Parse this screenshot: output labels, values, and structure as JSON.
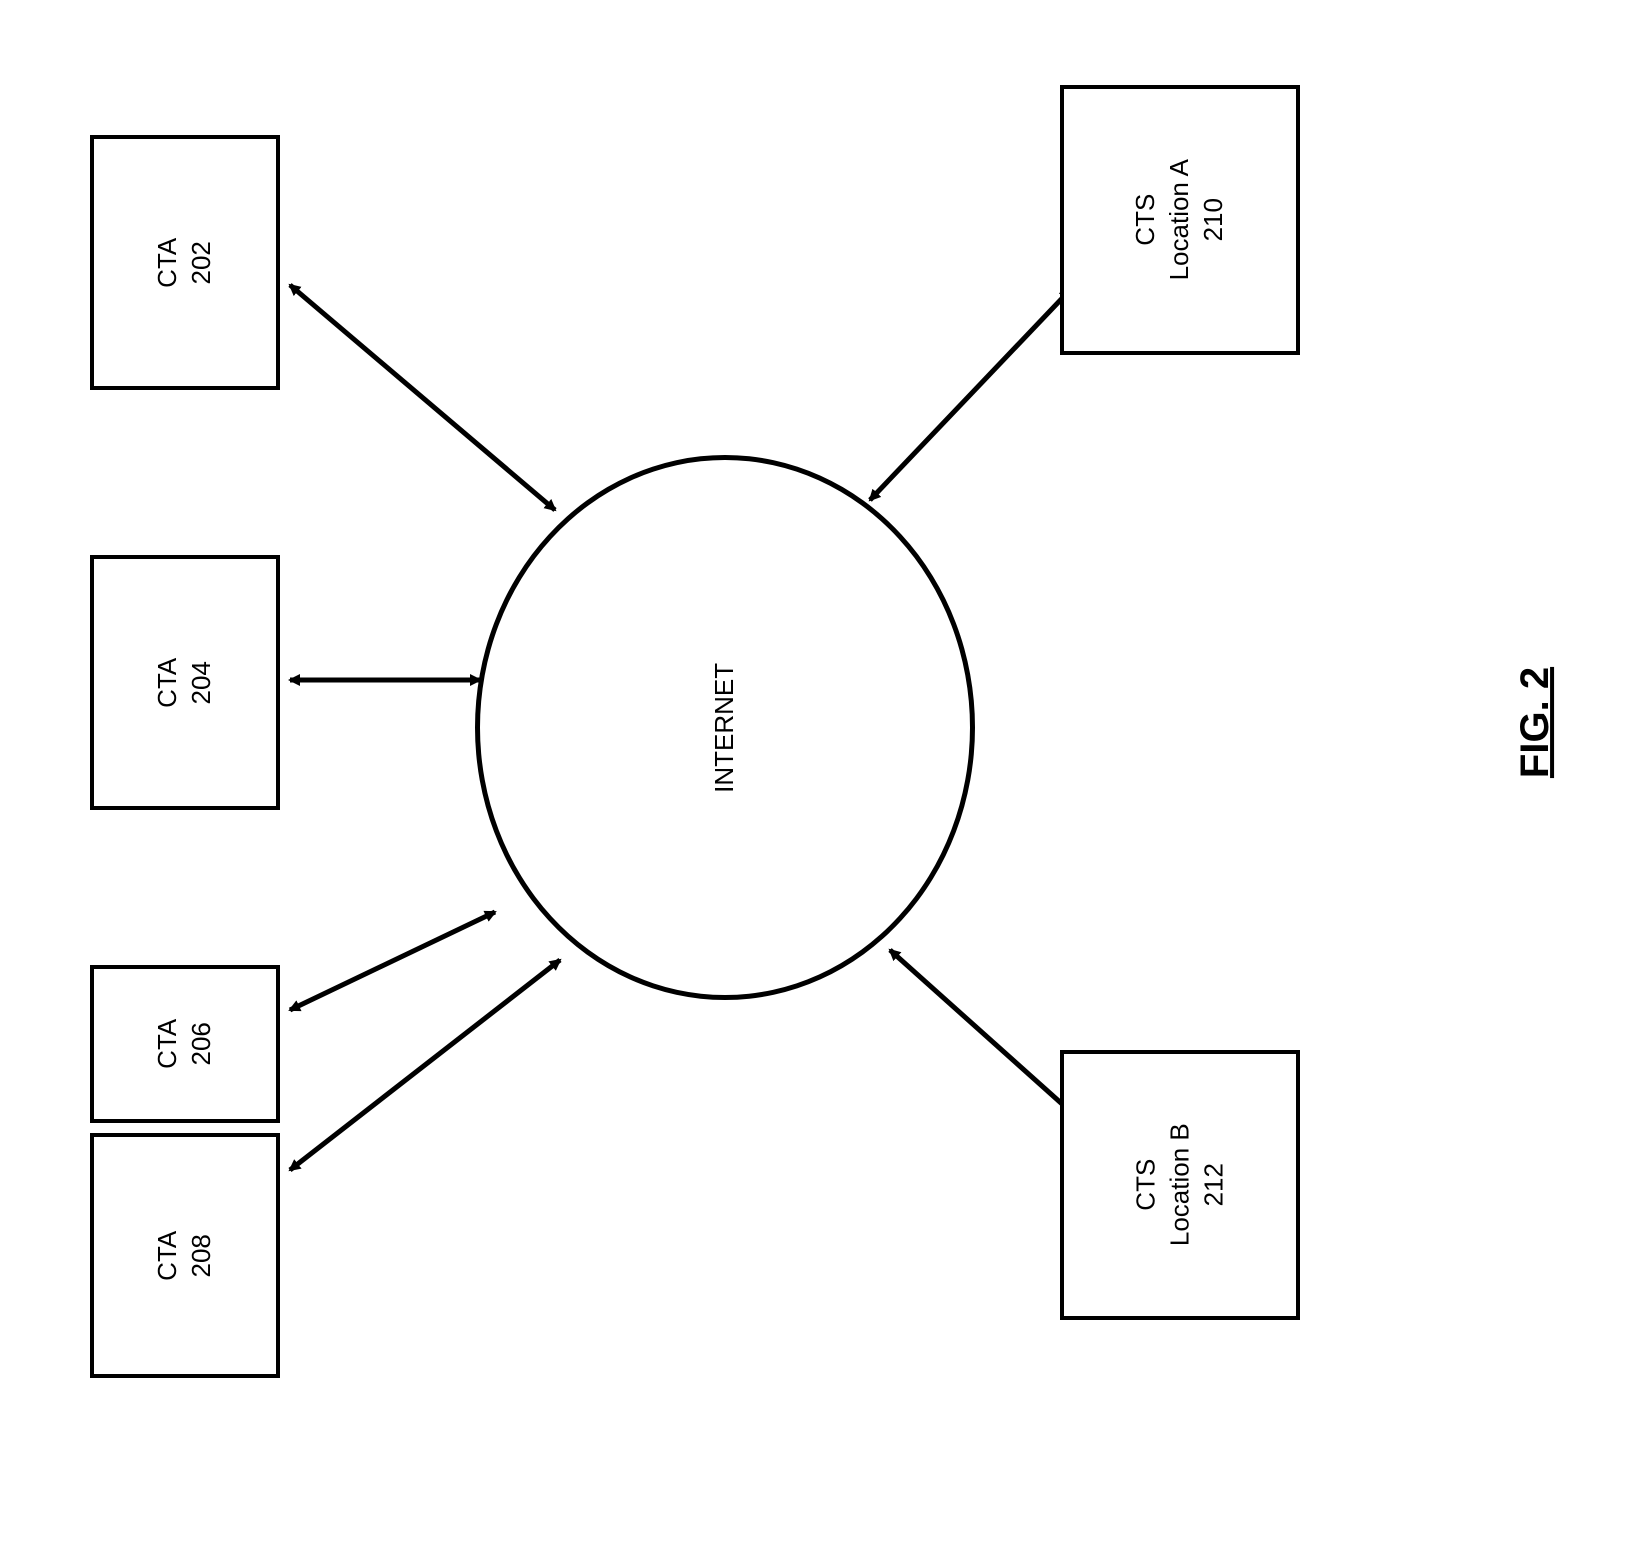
{
  "nodes": {
    "cta202": {
      "line1": "CTA",
      "line2": "202"
    },
    "cta204": {
      "line1": "CTA",
      "line2": "204"
    },
    "cta206": {
      "line1": "CTA",
      "line2": "206"
    },
    "cta208": {
      "line1": "CTA",
      "line2": "208"
    },
    "ctsA": {
      "line1": "CTS",
      "line2": "Location A",
      "line3": "210"
    },
    "ctsB": {
      "line1": "CTS",
      "line2": "Location B",
      "line3": "212"
    },
    "internet": {
      "label": "INTERNET"
    }
  },
  "caption": "FIG. 2"
}
